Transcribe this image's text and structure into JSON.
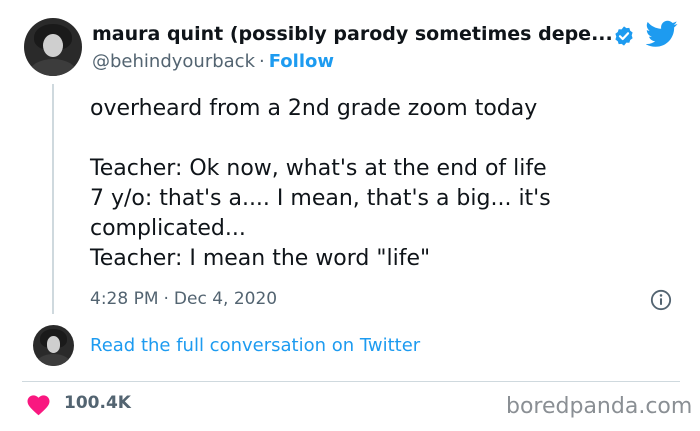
{
  "tweet": {
    "author": {
      "display_name": "maura quint (possibly parody sometimes depe...",
      "handle": "@behindyourback",
      "separator": "·",
      "follow_label": "Follow",
      "verified_icon": "verified-badge-icon"
    },
    "text_lines": [
      "overheard from a 2nd grade zoom today",
      "",
      "Teacher: Ok now, what's at the end of life",
      "7 y/o: that's a.... I mean, that's a big... it's",
      "complicated...",
      "Teacher: I mean the word \"life\""
    ],
    "time": "4:28 PM",
    "date_separator": "·",
    "date": "Dec 4, 2020",
    "read_more_label": "Read the full conversation on Twitter",
    "likes": "100.4K"
  },
  "watermark": "boredpanda.com",
  "colors": {
    "accent": "#1d9bf0",
    "heart": "#f91880",
    "secondary_text": "#536471",
    "divider": "#cfd9de"
  },
  "icons": {
    "brand": "twitter-bird-icon",
    "info": "info-icon",
    "like": "heart-icon"
  }
}
